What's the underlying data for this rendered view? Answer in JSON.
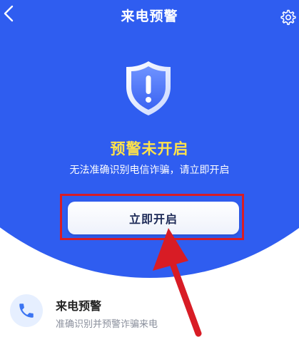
{
  "header": {
    "title": "来电预警",
    "back_icon": "chevron-left-icon",
    "settings_icon": "gear-icon"
  },
  "hero": {
    "shield_icon": "shield-exclamation-icon",
    "status_text": "预警未开启",
    "description": "无法准确识别电信诈骗，请立即开启",
    "button_label": "立即开启"
  },
  "feature": {
    "icon": "phone-icon",
    "title": "来电预警",
    "subtitle": "准确识别并预警诈骗来电"
  },
  "colors": {
    "primary": "#2f5df0",
    "status": "#ffe24a",
    "annotation": "#d81c25"
  }
}
